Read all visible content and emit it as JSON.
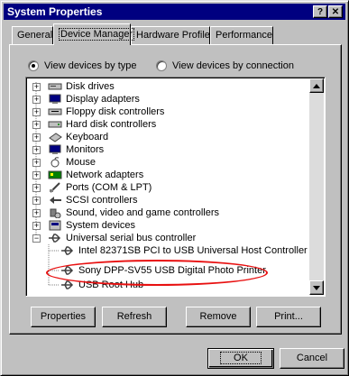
{
  "window": {
    "title": "System Properties",
    "help_label": "?",
    "close_label": "✕"
  },
  "tabs": [
    {
      "label": "General"
    },
    {
      "label": "Device Manager"
    },
    {
      "label": "Hardware Profiles"
    },
    {
      "label": "Performance"
    }
  ],
  "view_options": {
    "by_type": "View devices by type",
    "by_connection": "View devices by connection",
    "selected": "View devices by type"
  },
  "device_tree": [
    {
      "label": "Disk drives",
      "icon": "disk-drive-icon",
      "expanded": false
    },
    {
      "label": "Display adapters",
      "icon": "display-icon",
      "expanded": false
    },
    {
      "label": "Floppy disk controllers",
      "icon": "floppy-controller-icon",
      "expanded": false
    },
    {
      "label": "Hard disk controllers",
      "icon": "hard-disk-controller-icon",
      "expanded": false
    },
    {
      "label": "Keyboard",
      "icon": "keyboard-icon",
      "expanded": false
    },
    {
      "label": "Monitors",
      "icon": "monitor-icon",
      "expanded": false
    },
    {
      "label": "Mouse",
      "icon": "mouse-icon",
      "expanded": false
    },
    {
      "label": "Network adapters",
      "icon": "network-icon",
      "expanded": false
    },
    {
      "label": "Ports (COM & LPT)",
      "icon": "port-icon",
      "expanded": false
    },
    {
      "label": "SCSI controllers",
      "icon": "scsi-icon",
      "expanded": false
    },
    {
      "label": "Sound, video and game controllers",
      "icon": "sound-icon",
      "expanded": false
    },
    {
      "label": "System devices",
      "icon": "system-icon",
      "expanded": false
    },
    {
      "label": "Universal serial bus controller",
      "icon": "usb-icon",
      "expanded": true,
      "children": [
        {
          "label": "Intel 82371SB PCI to USB Universal Host Controller",
          "icon": "usb-icon"
        },
        {
          "label": "Sony DPP-SV55 USB Digital Photo Printer",
          "icon": "usb-icon",
          "highlighted": true
        },
        {
          "label": "USB Root Hub",
          "icon": "usb-icon"
        }
      ]
    }
  ],
  "panel_buttons": {
    "properties": "Properties",
    "refresh": "Refresh",
    "remove": "Remove",
    "print": "Print..."
  },
  "dialog_buttons": {
    "ok": "OK",
    "cancel": "Cancel"
  },
  "colors": {
    "titlebar": "#000080",
    "highlight_ellipse": "#e81010",
    "face": "#c0c0c0"
  }
}
